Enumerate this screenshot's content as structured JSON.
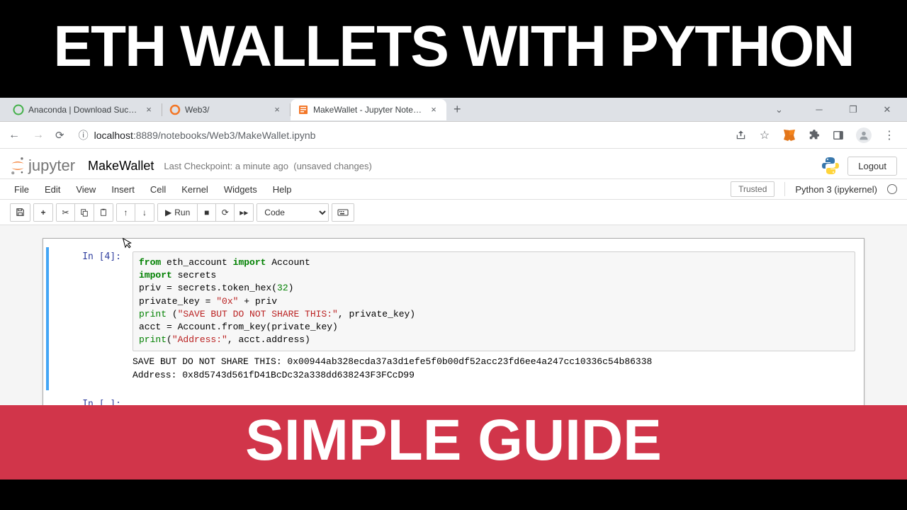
{
  "banner": {
    "top": "ETH WALLETS WITH PYTHON",
    "bottom": "SIMPLE GUIDE"
  },
  "tabs": [
    {
      "title": "Anaconda | Download Success P",
      "icon": "anaconda"
    },
    {
      "title": "Web3/",
      "icon": "jupyter"
    },
    {
      "title": "MakeWallet - Jupyter Notebook",
      "icon": "notebook",
      "active": true
    }
  ],
  "url": {
    "host": "localhost",
    "port_path": ":8889/notebooks/Web3/MakeWallet.ipynb"
  },
  "jupyter": {
    "logo": "jupyter",
    "title": "MakeWallet",
    "checkpoint": "Last Checkpoint: a minute ago",
    "unsaved": "(unsaved changes)",
    "logout": "Logout"
  },
  "menus": [
    "File",
    "Edit",
    "View",
    "Insert",
    "Cell",
    "Kernel",
    "Widgets",
    "Help"
  ],
  "trusted": "Trusted",
  "kernel_name": "Python 3 (ipykernel)",
  "toolbar": {
    "run": "Run",
    "celltype": "Code"
  },
  "cell1": {
    "prompt": "In [4]:",
    "output": "SAVE BUT DO NOT SHARE THIS: 0x00944ab328ecda37a3d1efe5f0b00df52acc23fd6ee4a247cc10336c54b86338\nAddress: 0x8d5743d561fD41BcDc32a338dd638243F3FCcD99"
  },
  "cell2": {
    "prompt": "In [ ]:"
  },
  "code": {
    "l1_from": "from",
    "l1_mod": " eth_account ",
    "l1_import": "import",
    "l1_name": " Account",
    "l2_import": "import",
    "l2_mod": " secrets",
    "l3_a": "priv = secrets.token_hex(",
    "l3_num": "32",
    "l3_b": ")",
    "l4_a": "private_key = ",
    "l4_s1": "\"0x\"",
    "l4_b": " + priv",
    "l5_print": "print",
    "l5_a": " (",
    "l5_s": "\"SAVE BUT DO NOT SHARE THIS:\"",
    "l5_b": ", private_key)",
    "l6": "acct = Account.from_key(private_key)",
    "l7_print": "print",
    "l7_a": "(",
    "l7_s": "\"Address:\"",
    "l7_b": ", acct.address)"
  }
}
